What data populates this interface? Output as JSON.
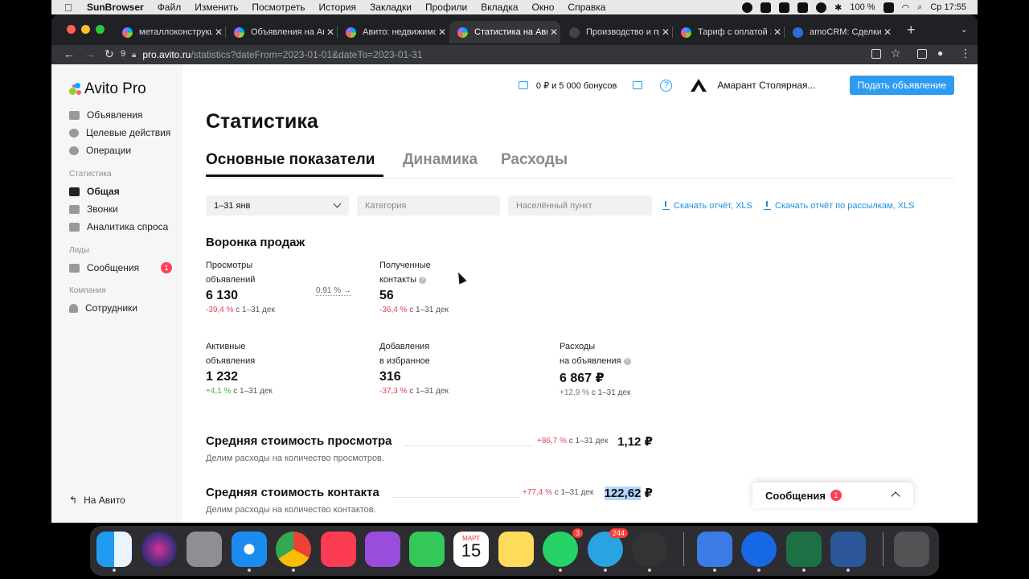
{
  "menubar": {
    "app": "SunBrowser",
    "items": [
      "Файл",
      "Изменить",
      "Посмотреть",
      "История",
      "Закладки",
      "Профили",
      "Вкладка",
      "Окно",
      "Справка"
    ],
    "battery": "100 %",
    "clock": "Ср  17:55"
  },
  "browser": {
    "tabs": [
      {
        "title": "металлоконструкции"
      },
      {
        "title": "Объявления на Авито"
      },
      {
        "title": "Авито: недвижимость"
      },
      {
        "title": "Статистика на Авито"
      },
      {
        "title": "Производство и продажа"
      },
      {
        "title": "Тариф с оплатой за"
      },
      {
        "title": "amoCRM: Сделки,"
      }
    ],
    "reload_count": "9",
    "url_host": "pro.avito.ru",
    "url_path": "/statistics?dateFrom=2023-01-01&dateTo=2023-01-31"
  },
  "sidebar": {
    "logo_text": "Avito Pro",
    "items": [
      {
        "label": "Объявления"
      },
      {
        "label": "Целевые действия"
      },
      {
        "label": "Операции"
      }
    ],
    "group_stats": "Статистика",
    "stats_items": [
      {
        "label": "Общая"
      },
      {
        "label": "Звонки"
      },
      {
        "label": "Аналитика спроса"
      }
    ],
    "group_leads": "Лиды",
    "leads_items": [
      {
        "label": "Сообщения",
        "badge": "1"
      }
    ],
    "group_company": "Компания",
    "company_items": [
      {
        "label": "Сотрудники"
      }
    ],
    "to_avito": "На Авито"
  },
  "topbar": {
    "balance": "0 ₽ и 5 000 бонусов",
    "help": "?",
    "company": "Амарант Столярная...",
    "post_button": "Подать объявление"
  },
  "page": {
    "title": "Статистика",
    "tabs": [
      "Основные показатели",
      "Динамика",
      "Расходы"
    ],
    "filters": {
      "period": "1–31 янв",
      "category_placeholder": "Категория",
      "city_placeholder": "Населённый пункт"
    },
    "downloads": [
      "Скачать отчёт, XLS",
      "Скачать отчёт по рассылкам, XLS"
    ],
    "funnel_title": "Воронка продаж",
    "conversion": "0,91 %",
    "metrics": [
      {
        "l1": "Просмотры",
        "l2": "объявлений",
        "value": "6 130",
        "change": "-39,4 %",
        "period": "с 1–31 дек",
        "trend": "neg"
      },
      {
        "l1": "Полученные",
        "l2": "контакты",
        "value": "56",
        "change": "-36,4 %",
        "period": "с 1–31 дек",
        "trend": "neg"
      },
      {
        "l1": "Активные",
        "l2": "объявления",
        "value": "1 232",
        "change": "+4,1 %",
        "period": "с 1–31 дек",
        "trend": "pos"
      },
      {
        "l1": "Добавления",
        "l2": "в избранное",
        "value": "316",
        "change": "-37,3 %",
        "period": "с 1–31 дек",
        "trend": "neg"
      },
      {
        "l1": "Расходы",
        "l2": "на объявления",
        "value": "6 867 ₽",
        "change": "+12,9 %",
        "period": "с 1–31 дек",
        "trend": "neu"
      }
    ],
    "costs": [
      {
        "title": "Средняя стоимость просмотра",
        "change": "+86,7 %",
        "period": "с 1–31 дек",
        "value": "1,12 ₽",
        "desc": "Делим расходы на количество просмотров."
      },
      {
        "title": "Средняя стоимость контакта",
        "change": "+77,4 %",
        "period": "с 1–31 дек",
        "value": "122,62",
        "currency": " ₽",
        "desc": "Делим расходы на количество контактов."
      }
    ]
  },
  "messages_widget": {
    "title": "Сообщения",
    "badge": "1"
  },
  "dock": {
    "calendar_month": "МАРТ",
    "calendar_day": "15",
    "whatsapp_badge": "3",
    "telegram_badge": "244"
  }
}
